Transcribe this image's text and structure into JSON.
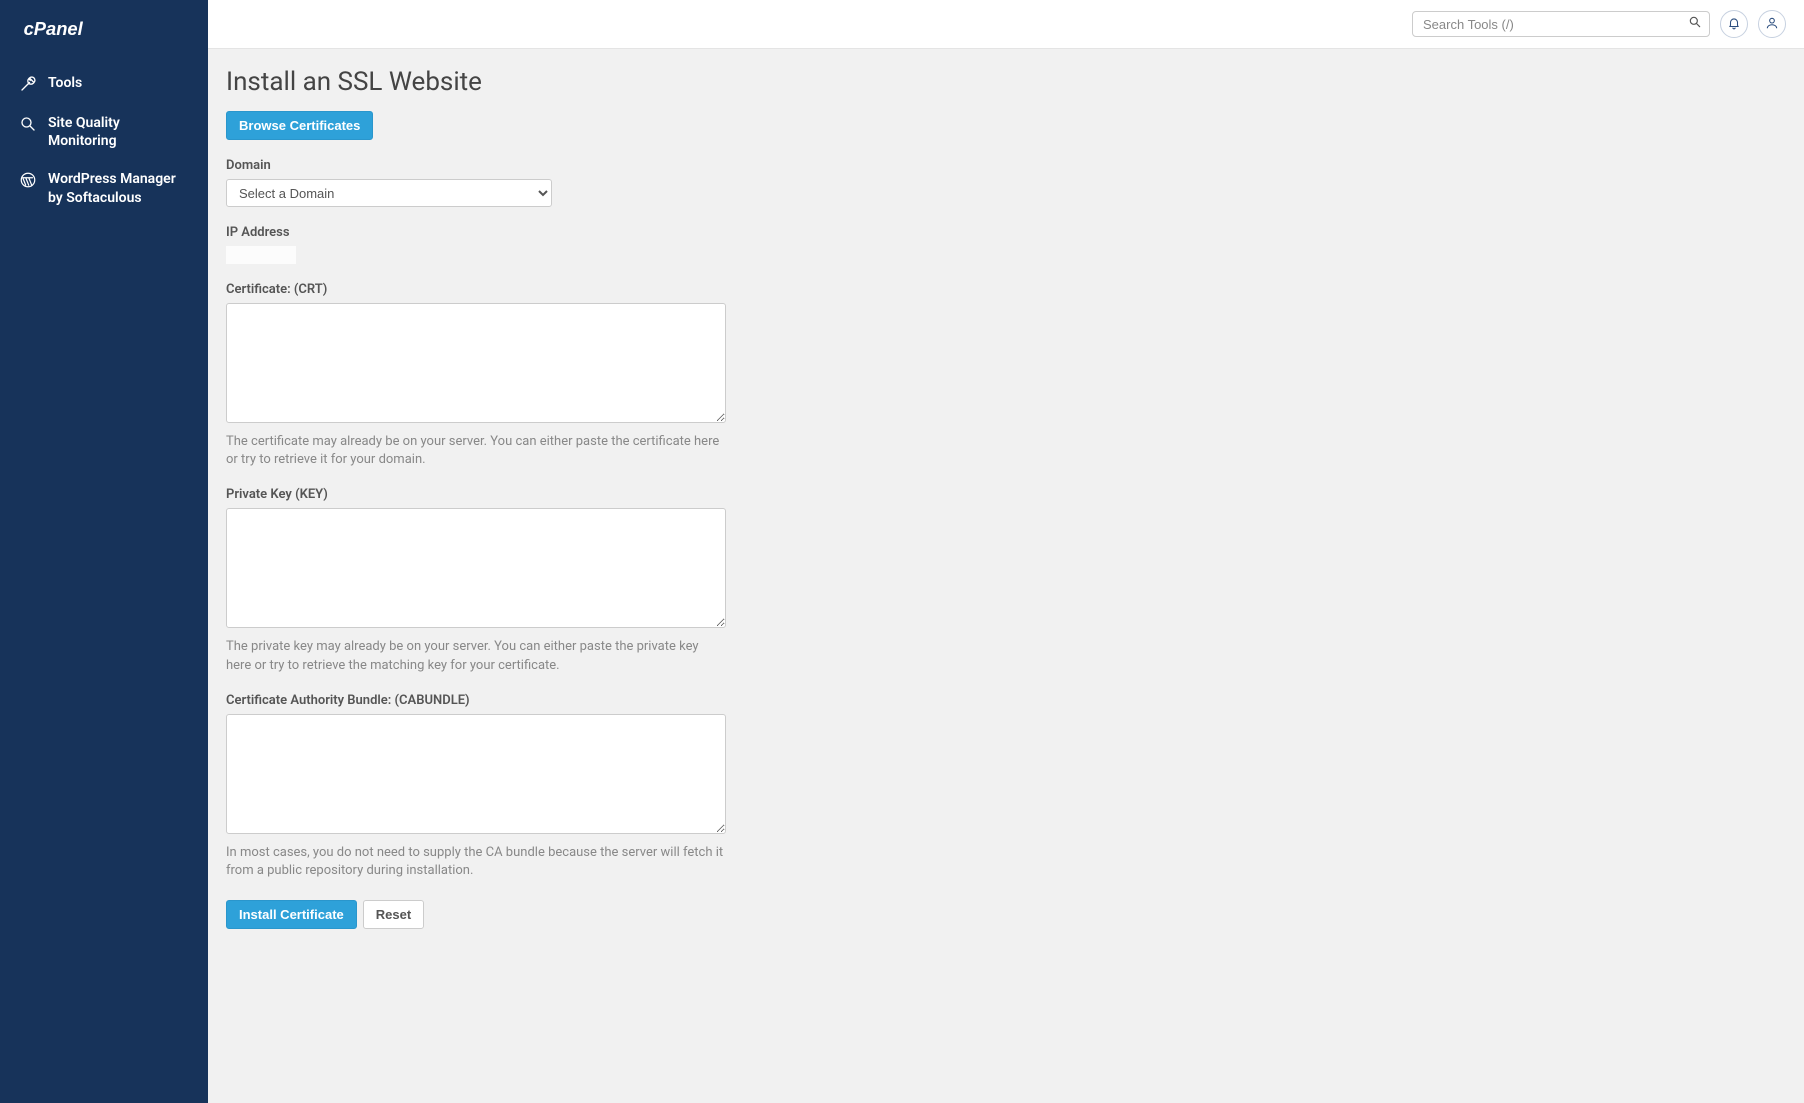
{
  "brand": "cPanel",
  "sidebar": {
    "items": [
      {
        "label": "Tools"
      },
      {
        "label": "Site Quality Monitoring"
      },
      {
        "label": "WordPress Manager by Softaculous"
      }
    ]
  },
  "header": {
    "search_placeholder": "Search Tools (/)"
  },
  "page": {
    "title": "Install an SSL Website",
    "browse_certs_label": "Browse Certificates",
    "domain": {
      "label": "Domain",
      "placeholder": "Select a Domain"
    },
    "ip": {
      "label": "IP Address",
      "value": ""
    },
    "crt": {
      "label": "Certificate: (CRT)",
      "help": "The certificate may already be on your server. You can either paste the certificate here or try to retrieve it for your domain."
    },
    "key": {
      "label": "Private Key (KEY)",
      "help": "The private key may already be on your server. You can either paste the private key here or try to retrieve the matching key for your certificate."
    },
    "cabundle": {
      "label": "Certificate Authority Bundle: (CABUNDLE)",
      "help": "In most cases, you do not need to supply the CA bundle because the server will fetch it from a public repository during installation."
    },
    "install_label": "Install Certificate",
    "reset_label": "Reset"
  }
}
